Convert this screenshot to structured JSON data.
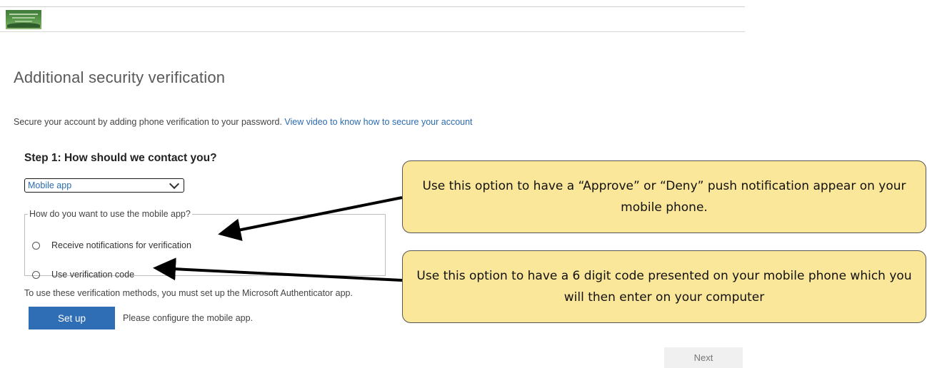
{
  "header": {
    "logo_icon": "college-logo-icon"
  },
  "page": {
    "title": "Additional security verification",
    "intro_text": "Secure your account by adding phone verification to your password.",
    "video_link": "View video to know how to secure your account"
  },
  "step1": {
    "heading": "Step 1: How should we contact you?",
    "method_select": {
      "selected": "Mobile app",
      "icon": "chevron-down-icon"
    },
    "mode_group": {
      "legend": "How do you want to use the mobile app?",
      "options": [
        {
          "label": "Receive notifications for verification",
          "selected": false
        },
        {
          "label": "Use verification code",
          "selected": false
        }
      ]
    },
    "authenticator_note": "To use these verification methods, you must set up the Microsoft Authenticator app.",
    "setup_button": "Set up",
    "setup_hint": "Please configure the mobile app."
  },
  "footer": {
    "next_button": "Next"
  },
  "callouts": [
    {
      "text": "Use this option to have a “Approve” or “Deny” push notification appear on your mobile phone."
    },
    {
      "text": "Use this option to have a 6 digit code presented on your mobile phone which you will then enter on your computer"
    }
  ],
  "colors": {
    "accent": "#2f6eb5",
    "link": "#2b6cb0",
    "callout_fill": "#fbe79a"
  }
}
